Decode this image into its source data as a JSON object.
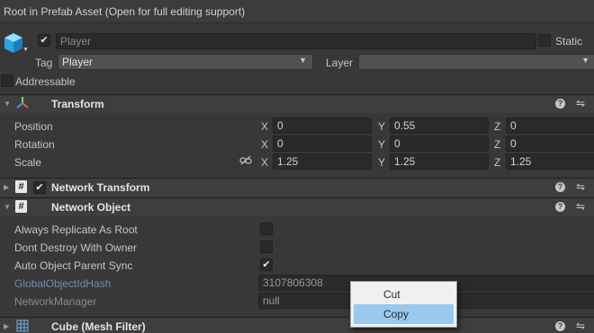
{
  "banner": "Root in Prefab Asset (Open for full editing support)",
  "object": {
    "active": true,
    "name_value": "Player",
    "static_label": "Static",
    "static_checked": false,
    "tag_label": "Tag",
    "tag_value": "Player",
    "layer_label": "Layer",
    "layer_value": "",
    "addressable_label": "Addressable",
    "addressable_checked": false
  },
  "transform": {
    "title": "Transform",
    "rows": [
      {
        "label": "Position",
        "x": "0",
        "y": "0.55",
        "z": "0"
      },
      {
        "label": "Rotation",
        "x": "0",
        "y": "0",
        "z": "0"
      },
      {
        "label": "Scale",
        "x": "1.25",
        "y": "1.25",
        "z": "1.25"
      }
    ],
    "axes": {
      "x": "X",
      "y": "Y",
      "z": "Z"
    }
  },
  "network_transform": {
    "title": "Network Transform",
    "enabled": true
  },
  "network_object": {
    "title": "Network Object",
    "fields": [
      {
        "label": "Always Replicate As Root",
        "checked": false
      },
      {
        "label": "Dont Destroy With Owner",
        "checked": false
      },
      {
        "label": "Auto Object Parent Sync",
        "checked": true
      }
    ],
    "hash_label": "GlobalObjectIdHash",
    "hash_value": "3107806308",
    "manager_label": "NetworkManager",
    "manager_value": "null"
  },
  "mesh_filter": {
    "title": "Cube (Mesh Filter)"
  },
  "context_menu": {
    "items": [
      "Cut",
      "Copy"
    ],
    "selected": "Copy"
  },
  "colors": {
    "background": "#383838",
    "selection": "#99c9ef",
    "link_text": "#6e8fb3"
  }
}
